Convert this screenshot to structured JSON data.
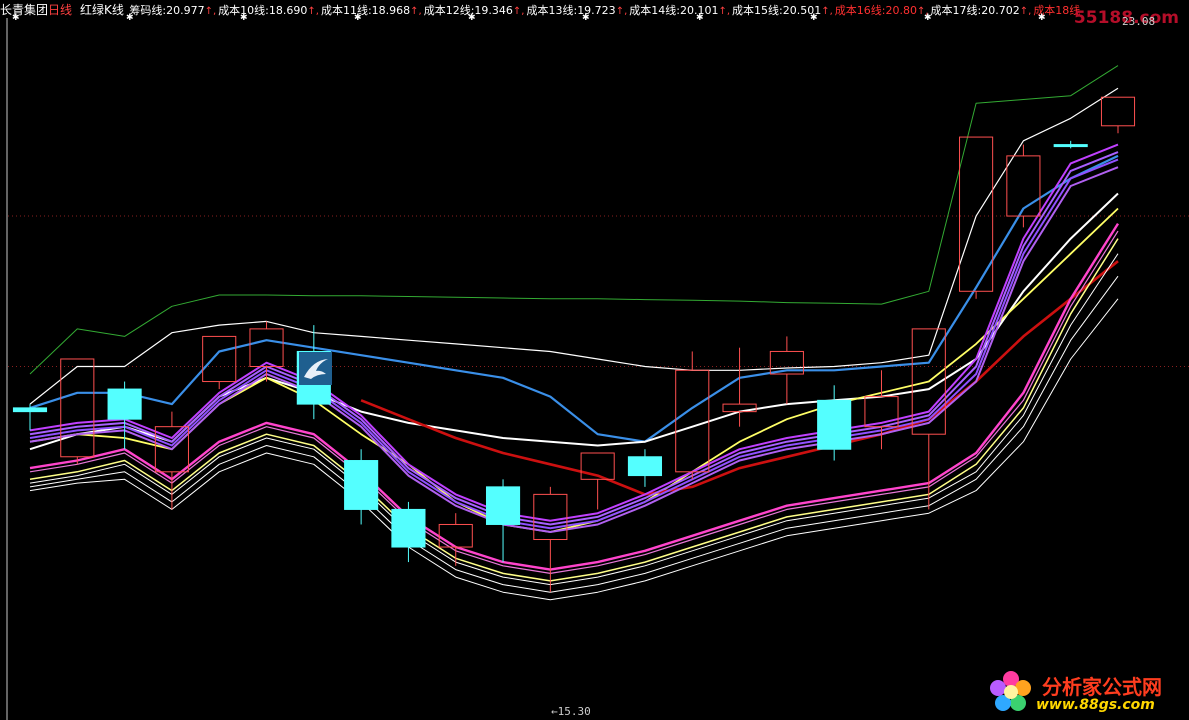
{
  "header": {
    "title": "长青集团",
    "period": "日线",
    "indicator": "红绿K线",
    "legend": [
      {
        "name": "筹码线:",
        "value": "20.977",
        "color": "#ffffff"
      },
      {
        "name": "成本10线:",
        "value": "18.690",
        "color": "#ffffff"
      },
      {
        "name": "成本11线:",
        "value": "18.968",
        "color": "#ffffff"
      },
      {
        "name": "成本12线:",
        "value": "19.346",
        "color": "#ffffff"
      },
      {
        "name": "成本13线:",
        "value": "19.723",
        "color": "#ffffff"
      },
      {
        "name": "成本14线:",
        "value": "20.101",
        "color": "#ffffff"
      },
      {
        "name": "成本15线:",
        "value": "20.501",
        "color": "#ffffff"
      },
      {
        "name": "成本16线:",
        "value": "20.80",
        "color": "#ff3030"
      },
      {
        "name": "成本17线:",
        "value": "20.702",
        "color": "#ffffff"
      },
      {
        "name": "成本18线",
        "value": "",
        "color": "#ff3030"
      }
    ],
    "arrow": "↑"
  },
  "annotations": {
    "high_label": "23.08",
    "low_label": "←15.30"
  },
  "watermarks": {
    "top_right": "55188.com",
    "bottom_brand": "分析家公式网",
    "bottom_url": "www.88gs.com"
  },
  "colors": {
    "background": "#000000",
    "up_candle": "#ff5050",
    "down_candle": "#54ffff",
    "blue_line": "#3a8fe8",
    "red_line": "#cc1010",
    "green_line": "#33aa33",
    "yellow_line": "#ffff66",
    "magenta_band": "#b040ff"
  },
  "chart_data": {
    "type": "candlestick",
    "y_range": [
      15.0,
      24.0
    ],
    "high_marker": 23.08,
    "low_marker": 15.3,
    "grid": "dotted-horizontal",
    "candles": [
      {
        "o": 18.9,
        "h": 19.0,
        "l": 18.65,
        "c": 18.95,
        "up": false
      },
      {
        "o": 18.3,
        "h": 19.6,
        "l": 18.2,
        "c": 19.6,
        "up": true
      },
      {
        "o": 18.8,
        "h": 19.3,
        "l": 18.4,
        "c": 19.2,
        "up": false
      },
      {
        "o": 18.1,
        "h": 18.9,
        "l": 17.6,
        "c": 18.7,
        "up": true
      },
      {
        "o": 19.3,
        "h": 19.9,
        "l": 19.2,
        "c": 19.9,
        "up": true
      },
      {
        "o": 19.5,
        "h": 20.1,
        "l": 19.3,
        "c": 20.0,
        "up": true
      },
      {
        "o": 19.7,
        "h": 20.05,
        "l": 18.8,
        "c": 19.0,
        "up": false
      },
      {
        "o": 18.25,
        "h": 18.4,
        "l": 17.4,
        "c": 17.6,
        "up": false
      },
      {
        "o": 17.6,
        "h": 17.7,
        "l": 16.9,
        "c": 17.1,
        "up": false
      },
      {
        "o": 17.1,
        "h": 17.55,
        "l": 16.85,
        "c": 17.4,
        "up": true
      },
      {
        "o": 17.9,
        "h": 18.0,
        "l": 16.9,
        "c": 17.4,
        "up": false
      },
      {
        "o": 17.2,
        "h": 17.9,
        "l": 16.5,
        "c": 17.8,
        "up": true
      },
      {
        "o": 18.0,
        "h": 18.35,
        "l": 17.6,
        "c": 18.35,
        "up": true
      },
      {
        "o": 18.3,
        "h": 18.4,
        "l": 17.9,
        "c": 18.05,
        "up": false
      },
      {
        "o": 18.1,
        "h": 19.7,
        "l": 18.0,
        "c": 19.45,
        "up": true
      },
      {
        "o": 18.9,
        "h": 19.75,
        "l": 18.7,
        "c": 19.0,
        "up": true
      },
      {
        "o": 19.4,
        "h": 19.9,
        "l": 19.0,
        "c": 19.7,
        "up": true
      },
      {
        "o": 19.05,
        "h": 19.25,
        "l": 18.25,
        "c": 18.4,
        "up": false
      },
      {
        "o": 18.7,
        "h": 19.45,
        "l": 18.4,
        "c": 19.1,
        "up": true
      },
      {
        "o": 18.6,
        "h": 20.0,
        "l": 17.6,
        "c": 20.0,
        "up": true
      },
      {
        "o": 20.5,
        "h": 22.55,
        "l": 20.4,
        "c": 22.55,
        "up": true
      },
      {
        "o": 21.5,
        "h": 22.45,
        "l": 21.35,
        "c": 22.3,
        "up": true
      },
      {
        "o": 22.45,
        "h": 22.5,
        "l": 22.4,
        "c": 22.45,
        "up": false
      },
      {
        "o": 22.7,
        "h": 23.08,
        "l": 22.6,
        "c": 23.08,
        "up": true
      }
    ],
    "lines": [
      {
        "name": "green",
        "color": "#33aa33",
        "width": 1,
        "values": [
          19.4,
          20.0,
          19.9,
          20.3,
          20.45,
          20.45,
          20.44,
          20.44,
          20.43,
          20.42,
          20.41,
          20.4,
          20.4,
          20.39,
          20.38,
          20.37,
          20.35,
          20.34,
          20.33,
          20.5,
          23.0,
          23.05,
          23.1,
          23.5
        ]
      },
      {
        "name": "white-top",
        "color": "#ffffff",
        "width": 1.2,
        "values": [
          19.0,
          19.5,
          19.5,
          19.95,
          20.05,
          20.1,
          19.95,
          19.9,
          19.85,
          19.8,
          19.75,
          19.7,
          19.6,
          19.5,
          19.45,
          19.45,
          19.48,
          19.5,
          19.55,
          19.65,
          21.5,
          22.5,
          22.8,
          23.2
        ]
      },
      {
        "name": "blue",
        "color": "#3a8fe8",
        "width": 2.2,
        "values": [
          18.95,
          19.15,
          19.15,
          19.0,
          19.7,
          19.85,
          19.75,
          19.65,
          19.55,
          19.45,
          19.35,
          19.1,
          18.6,
          18.5,
          18.95,
          19.35,
          19.45,
          19.45,
          19.5,
          19.55,
          20.55,
          21.6,
          22.0,
          22.3
        ]
      },
      {
        "name": "white-mid",
        "color": "#ffffff",
        "width": 2,
        "values": [
          18.4,
          18.6,
          18.7,
          18.5,
          19.1,
          19.35,
          19.15,
          18.9,
          18.75,
          18.65,
          18.55,
          18.5,
          18.45,
          18.5,
          18.7,
          18.9,
          19.0,
          19.05,
          19.1,
          19.2,
          19.6,
          20.5,
          21.2,
          21.8
        ]
      },
      {
        "name": "yellow",
        "color": "#ffff66",
        "width": 1.8,
        "values": [
          18.5,
          18.6,
          18.55,
          18.4,
          19.0,
          19.35,
          19.05,
          18.6,
          18.2,
          17.7,
          17.4,
          17.3,
          17.45,
          17.7,
          18.1,
          18.5,
          18.8,
          19.0,
          19.15,
          19.3,
          19.8,
          20.4,
          21.0,
          21.6
        ]
      },
      {
        "name": "red",
        "color": "#cc1010",
        "width": 2.6,
        "values": [
          null,
          null,
          null,
          null,
          null,
          null,
          null,
          19.05,
          18.8,
          18.55,
          18.35,
          18.2,
          18.05,
          17.8,
          17.9,
          18.15,
          18.3,
          18.45,
          18.6,
          18.8,
          19.3,
          19.9,
          20.4,
          20.9
        ]
      },
      {
        "name": "magenta-1",
        "color": "#c040ff",
        "width": 2,
        "values": [
          18.65,
          18.75,
          18.8,
          18.55,
          19.15,
          19.55,
          19.3,
          18.85,
          18.2,
          17.8,
          17.55,
          17.45,
          17.55,
          17.8,
          18.1,
          18.4,
          18.55,
          18.65,
          18.75,
          18.9,
          19.6,
          21.2,
          22.2,
          22.45
        ]
      },
      {
        "name": "magenta-2",
        "color": "#a860ff",
        "width": 2,
        "values": [
          18.6,
          18.7,
          18.75,
          18.5,
          19.1,
          19.5,
          19.25,
          18.8,
          18.15,
          17.75,
          17.5,
          17.4,
          17.5,
          17.75,
          18.05,
          18.35,
          18.5,
          18.6,
          18.7,
          18.85,
          19.5,
          21.1,
          22.1,
          22.35
        ]
      },
      {
        "name": "magenta-3",
        "color": "#9050ff",
        "width": 2,
        "values": [
          18.55,
          18.65,
          18.7,
          18.45,
          19.05,
          19.45,
          19.2,
          18.75,
          18.1,
          17.7,
          17.45,
          17.35,
          17.45,
          17.7,
          18.0,
          18.3,
          18.45,
          18.55,
          18.65,
          18.8,
          19.4,
          21.0,
          22.0,
          22.25
        ]
      },
      {
        "name": "magenta-4",
        "color": "#b060f0",
        "width": 2,
        "values": [
          18.5,
          18.6,
          18.65,
          18.4,
          19.0,
          19.4,
          19.15,
          18.7,
          18.05,
          17.65,
          17.4,
          17.3,
          17.4,
          17.65,
          17.95,
          18.25,
          18.4,
          18.5,
          18.6,
          18.75,
          19.3,
          20.9,
          21.9,
          22.15
        ]
      },
      {
        "name": "pink-low-1",
        "color": "#ff44cc",
        "width": 2.4,
        "values": [
          18.15,
          18.25,
          18.4,
          18.0,
          18.5,
          18.75,
          18.6,
          18.1,
          17.5,
          17.1,
          16.9,
          16.8,
          16.9,
          17.05,
          17.25,
          17.45,
          17.65,
          17.75,
          17.85,
          17.95,
          18.35,
          19.15,
          20.4,
          21.4
        ]
      },
      {
        "name": "pink-low-2",
        "color": "#e878d8",
        "width": 1.2,
        "values": [
          18.1,
          18.2,
          18.35,
          17.95,
          18.45,
          18.7,
          18.55,
          18.05,
          17.45,
          17.05,
          16.85,
          16.75,
          16.85,
          17.0,
          17.2,
          17.4,
          17.6,
          17.7,
          17.8,
          17.9,
          18.3,
          19.05,
          20.3,
          21.3
        ]
      },
      {
        "name": "yellow-low",
        "color": "#ffff88",
        "width": 1.5,
        "values": [
          18.0,
          18.1,
          18.25,
          17.85,
          18.35,
          18.6,
          18.45,
          17.95,
          17.35,
          16.95,
          16.75,
          16.65,
          16.75,
          16.9,
          17.1,
          17.3,
          17.5,
          17.6,
          17.7,
          17.8,
          18.2,
          18.95,
          20.2,
          21.2
        ]
      },
      {
        "name": "white-low-1",
        "color": "#ffffff",
        "width": 1,
        "values": [
          17.95,
          18.05,
          18.2,
          17.8,
          18.3,
          18.55,
          18.4,
          17.9,
          17.3,
          16.9,
          16.7,
          16.6,
          16.7,
          16.85,
          17.05,
          17.25,
          17.45,
          17.55,
          17.65,
          17.75,
          18.1,
          18.85,
          20.05,
          21.0
        ]
      },
      {
        "name": "white-low-2",
        "color": "#ffffff",
        "width": 1,
        "values": [
          17.9,
          18.0,
          18.1,
          17.7,
          18.2,
          18.45,
          18.3,
          17.8,
          17.2,
          16.8,
          16.6,
          16.5,
          16.6,
          16.75,
          16.95,
          17.15,
          17.35,
          17.45,
          17.55,
          17.65,
          18.0,
          18.7,
          19.85,
          20.7
        ]
      },
      {
        "name": "white-low-3",
        "color": "#ffffff",
        "width": 1,
        "values": [
          17.85,
          17.95,
          18.0,
          17.6,
          18.1,
          18.35,
          18.2,
          17.7,
          17.1,
          16.7,
          16.5,
          16.4,
          16.5,
          16.65,
          16.85,
          17.05,
          17.25,
          17.35,
          17.45,
          17.55,
          17.85,
          18.5,
          19.6,
          20.4
        ]
      }
    ]
  }
}
